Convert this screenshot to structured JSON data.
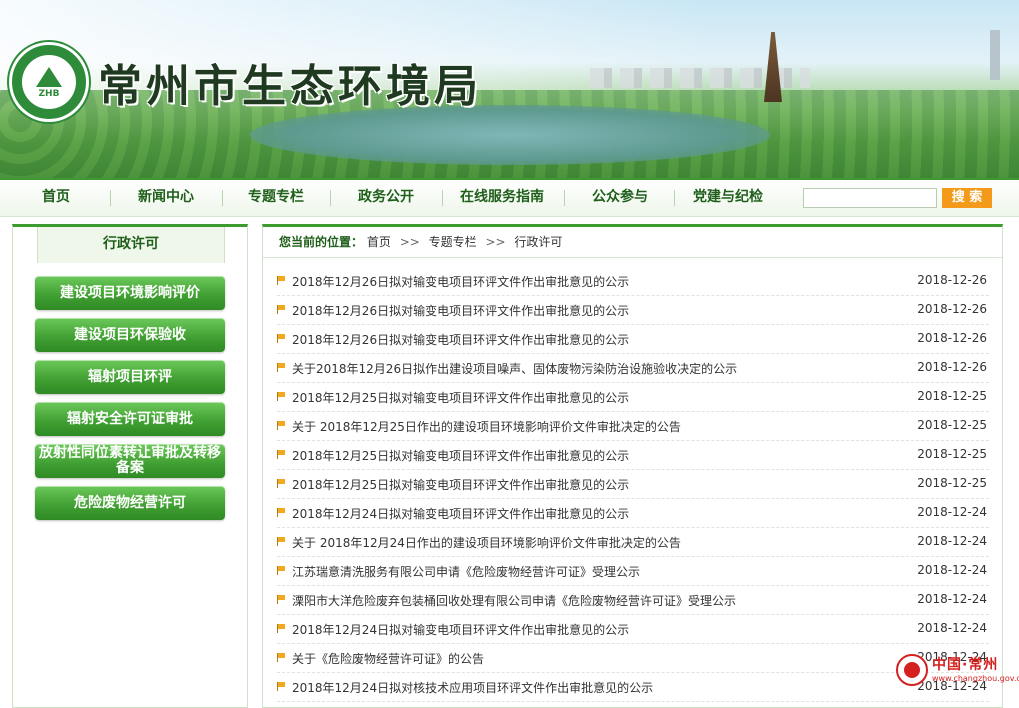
{
  "site": {
    "title": "常州市生态环境局",
    "logo_text": "ZHB"
  },
  "nav": {
    "items": [
      "首页",
      "新闻中心",
      "专题专栏",
      "政务公开",
      "在线服务指南",
      "公众参与",
      "党建与纪检"
    ],
    "search_placeholder": "",
    "search_button": "搜 索"
  },
  "sidebar": {
    "title": "行政许可",
    "items": [
      "建设项目环境影响评价",
      "建设项目环保验收",
      "辐射项目环评",
      "辐射安全许可证审批",
      "放射性同位素转让审批及转移备案",
      "危险废物经营许可"
    ]
  },
  "breadcrumb": {
    "label": "您当前的位置：",
    "items": [
      "首页",
      "专题专栏",
      "行政许可"
    ],
    "separator": ">>"
  },
  "list": [
    {
      "title": "2018年12月26日拟对输变电项目环评文件作出审批意见的公示",
      "date": "2018-12-26"
    },
    {
      "title": "2018年12月26日拟对输变电项目环评文件作出审批意见的公示",
      "date": "2018-12-26"
    },
    {
      "title": "2018年12月26日拟对输变电项目环评文件作出审批意见的公示",
      "date": "2018-12-26"
    },
    {
      "title": "关于2018年12月26日拟作出建设项目噪声、固体废物污染防治设施验收决定的公示",
      "date": "2018-12-26"
    },
    {
      "title": "2018年12月25日拟对输变电项目环评文件作出审批意见的公示",
      "date": "2018-12-25"
    },
    {
      "title": "关于 2018年12月25日作出的建设项目环境影响评价文件审批决定的公告",
      "date": "2018-12-25"
    },
    {
      "title": "2018年12月25日拟对输变电项目环评文件作出审批意见的公示",
      "date": "2018-12-25"
    },
    {
      "title": "2018年12月25日拟对输变电项目环评文件作出审批意见的公示",
      "date": "2018-12-25"
    },
    {
      "title": "2018年12月24日拟对输变电项目环评文件作出审批意见的公示",
      "date": "2018-12-24"
    },
    {
      "title": "关于 2018年12月24日作出的建设项目环境影响评价文件审批决定的公告",
      "date": "2018-12-24"
    },
    {
      "title": "江苏瑞意清洗服务有限公司申请《危险废物经营许可证》受理公示",
      "date": "2018-12-24"
    },
    {
      "title": "溧阳市大洋危险废弃包装桶回收处理有限公司申请《危险废物经营许可证》受理公示",
      "date": "2018-12-24"
    },
    {
      "title": "2018年12月24日拟对输变电项目环评文件作出审批意见的公示",
      "date": "2018-12-24"
    },
    {
      "title": "关于《危险废物经营许可证》的公告",
      "date": "2018-12-24"
    },
    {
      "title": "2018年12月24日拟对核技术应用项目环评文件作出审批意见的公示",
      "date": "2018-12-24"
    }
  ],
  "watermark": {
    "text": "中国·常州",
    "url": "www.changzhou.gov.cn"
  },
  "colors": {
    "brand_green": "#3d9a2f",
    "nav_text": "#1f5f1a",
    "search_button": "#f39a1a",
    "watermark_red": "#d4201e"
  }
}
